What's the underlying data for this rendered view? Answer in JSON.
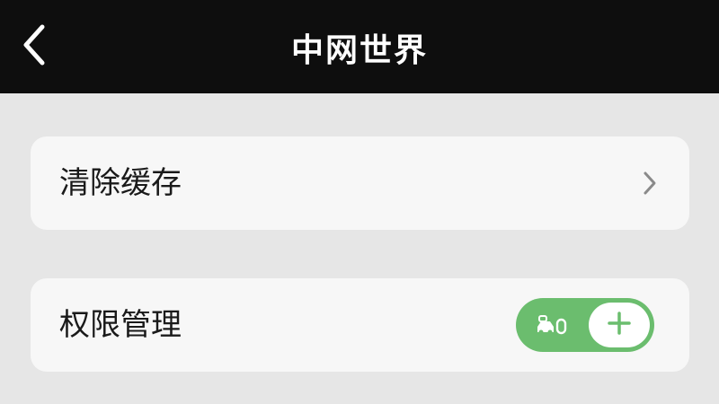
{
  "header": {
    "title": "中网世界",
    "back_icon": "chevron-left-icon"
  },
  "settings": {
    "items": [
      {
        "label": "清除缓存",
        "trailing": "chevron-right-icon"
      },
      {
        "label": "权限管理",
        "toggle": {
          "state": "on",
          "left_icon": "car-lock-icon",
          "knob_icon": "plus-icon"
        }
      }
    ]
  },
  "colors": {
    "header_bg": "#0e0e0e",
    "page_bg": "#e6e6e6",
    "card_bg": "#f7f7f7",
    "toggle_on": "#6bbd6e"
  }
}
